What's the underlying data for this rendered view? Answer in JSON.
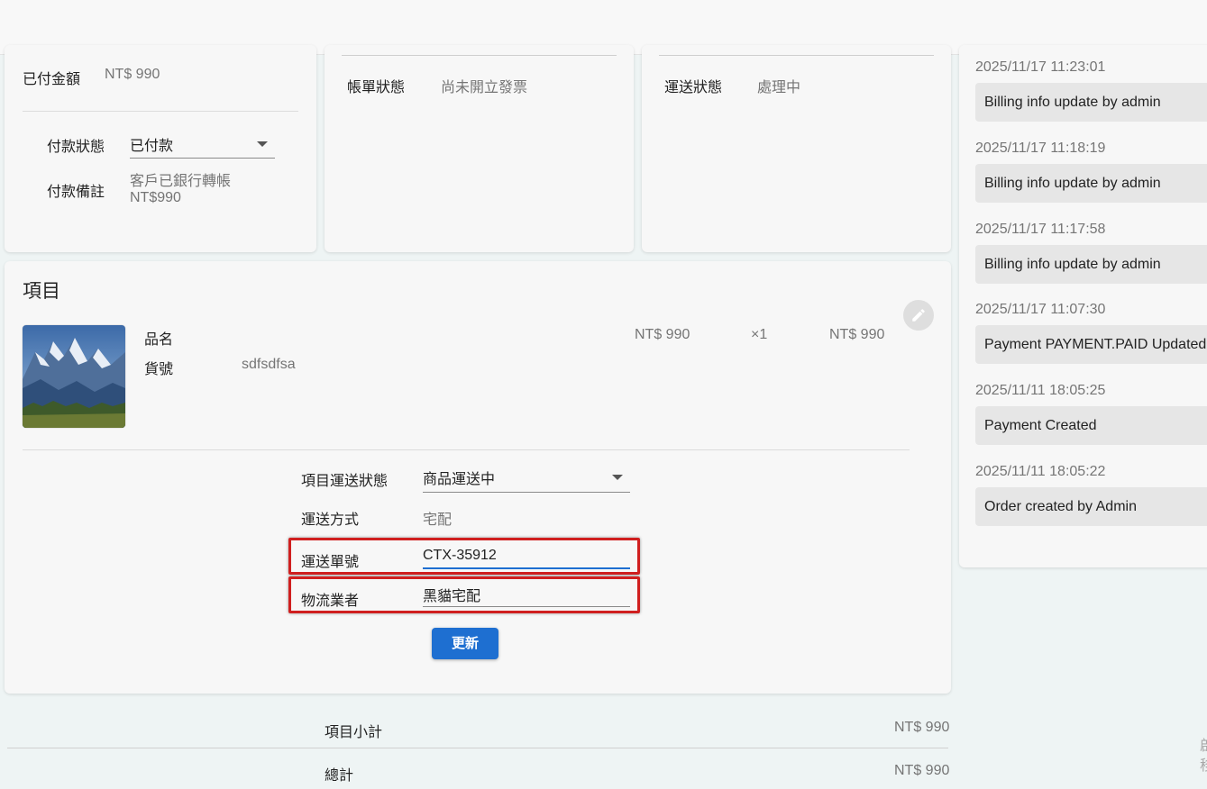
{
  "payment": {
    "paid_amount_label": "已付金額",
    "paid_amount_value": "NT$ 990",
    "status_label": "付款狀態",
    "status_value": "已付款",
    "note_label": "付款備註",
    "note_line1": "客戶已銀行轉帳",
    "note_line2": "NT$990"
  },
  "billing": {
    "status_label": "帳單狀態",
    "status_value": "尚未開立發票"
  },
  "shipping": {
    "status_label": "運送狀態",
    "status_value": "處理中"
  },
  "items": {
    "title": "項目",
    "item": {
      "name_label": "品名",
      "sku_label": "貨號",
      "sku_value": "sdfsdfsa",
      "unit_price": "NT$ 990",
      "quantity": "×1",
      "total": "NT$ 990"
    },
    "form": {
      "ship_status_label": "項目運送狀態",
      "ship_status_value": "商品運送中",
      "method_label": "運送方式",
      "method_value": "宅配",
      "tracking_label": "運送單號",
      "tracking_value": "CTX-35912",
      "carrier_label": "物流業者",
      "carrier_value": "黑貓宅配",
      "update_button": "更新"
    }
  },
  "summary": {
    "subtotal_label": "項目小計",
    "subtotal_value": "NT$ 990",
    "total_label": "總計",
    "total_value": "NT$ 990"
  },
  "history": [
    {
      "time": "2025/11/17 11:23:01",
      "text": "Billing info update by admin"
    },
    {
      "time": "2025/11/17 11:18:19",
      "text": "Billing info update by admin"
    },
    {
      "time": "2025/11/17 11:17:58",
      "text": "Billing info update by admin"
    },
    {
      "time": "2025/11/17 11:07:30",
      "text": "Payment PAYMENT.PAID Updated"
    },
    {
      "time": "2025/11/11 18:05:25",
      "text": "Payment Created"
    },
    {
      "time": "2025/11/11 18:05:22",
      "text": "Order created by Admin"
    }
  ],
  "edge_text": {
    "line1": "啟",
    "line2": "移"
  },
  "icons": {
    "edit": "pencil-icon",
    "dropdown": "caret-down-icon",
    "image": "mountain-image"
  },
  "colors": {
    "primary": "#1e6fd1",
    "highlight": "#d01f1f"
  }
}
